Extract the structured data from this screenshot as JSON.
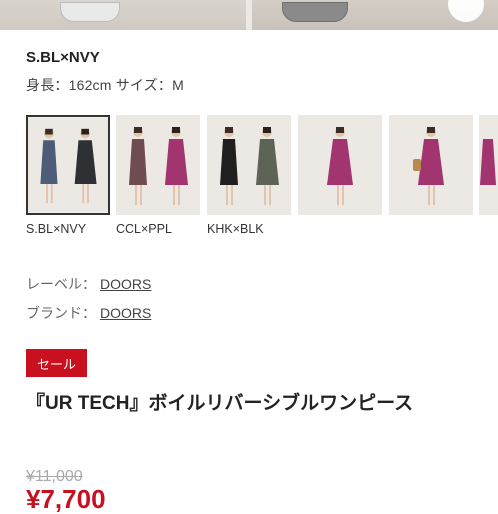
{
  "color_name": "S.BL×NVY",
  "model_info": "身長：162cm サイズ：M",
  "variants": [
    {
      "label": "S.BL×NVY",
      "selected": true,
      "colors": [
        "#4d5c78",
        "#2f3034"
      ]
    },
    {
      "label": "CCL×PPL",
      "selected": false,
      "colors": [
        "#6e4c50",
        "#a2346f"
      ]
    },
    {
      "label": "KHK×BLK",
      "selected": false,
      "colors": [
        "#1f1f1f",
        "#5d6456"
      ]
    },
    {
      "label": "",
      "selected": false,
      "colors": [
        "#a2346f"
      ]
    },
    {
      "label": "",
      "selected": false,
      "colors": [
        "#a2346f"
      ]
    },
    {
      "label": "",
      "selected": false,
      "colors": [
        "#a2346f"
      ]
    }
  ],
  "meta": {
    "label_key": "レーベル：",
    "label_value": "DOORS",
    "brand_key": "ブランド：",
    "brand_value": "DOORS"
  },
  "sale_badge": "セール",
  "product_title": "『UR TECH』ボイルリバーシブルワンピース",
  "old_price": "¥11,000",
  "new_price": "¥7,700"
}
